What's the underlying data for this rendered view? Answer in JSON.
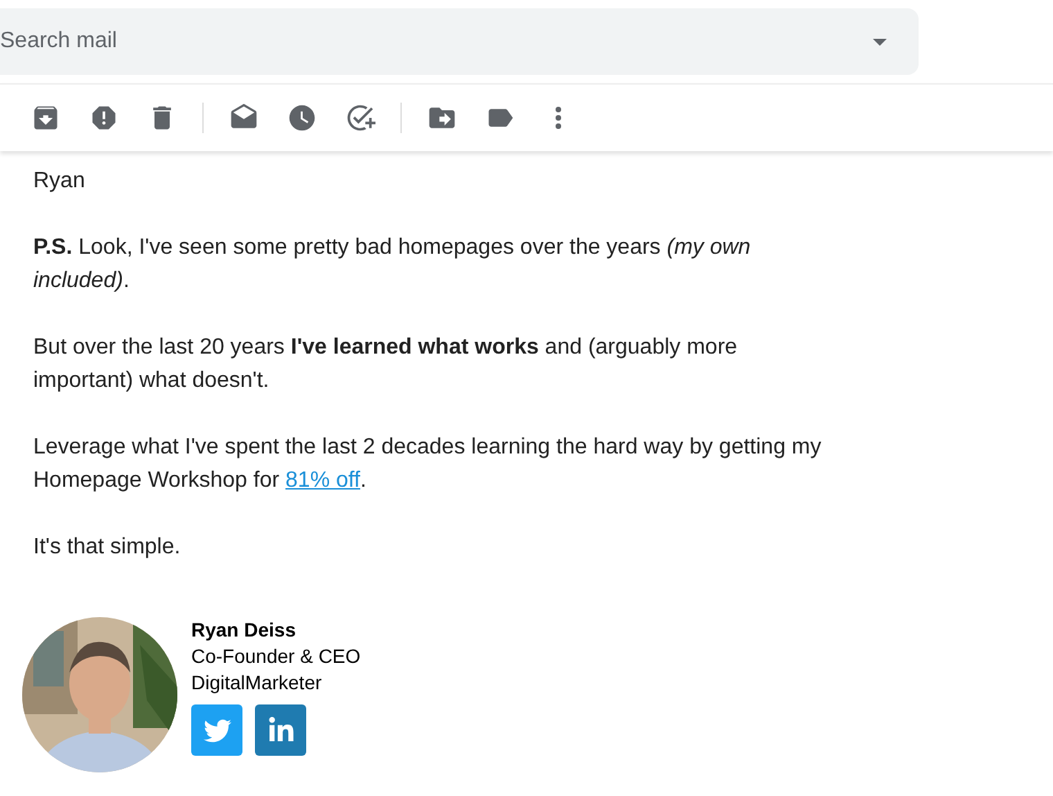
{
  "search": {
    "placeholder": "Search mail"
  },
  "body": {
    "paragraphs": [
      {
        "lines": [
          "Ryan"
        ]
      },
      {
        "text": "**P.S.** Look, I've seen some pretty bad homepages over the years *(my own included)*."
      },
      {
        "text": "But over the last 20 years **I've learned what works** and (arguably more important) what doesn't."
      },
      {
        "text": "Leverage what I've spent the last 2 decades learning the hard way by getting my Homepage Workshop for ",
        "link": "81% off",
        "after": "."
      },
      {
        "text": "It's that simple."
      }
    ]
  },
  "signature": {
    "name": "Ryan Deiss",
    "title": "Co-Founder & CEO",
    "company": "DigitalMarketer"
  }
}
